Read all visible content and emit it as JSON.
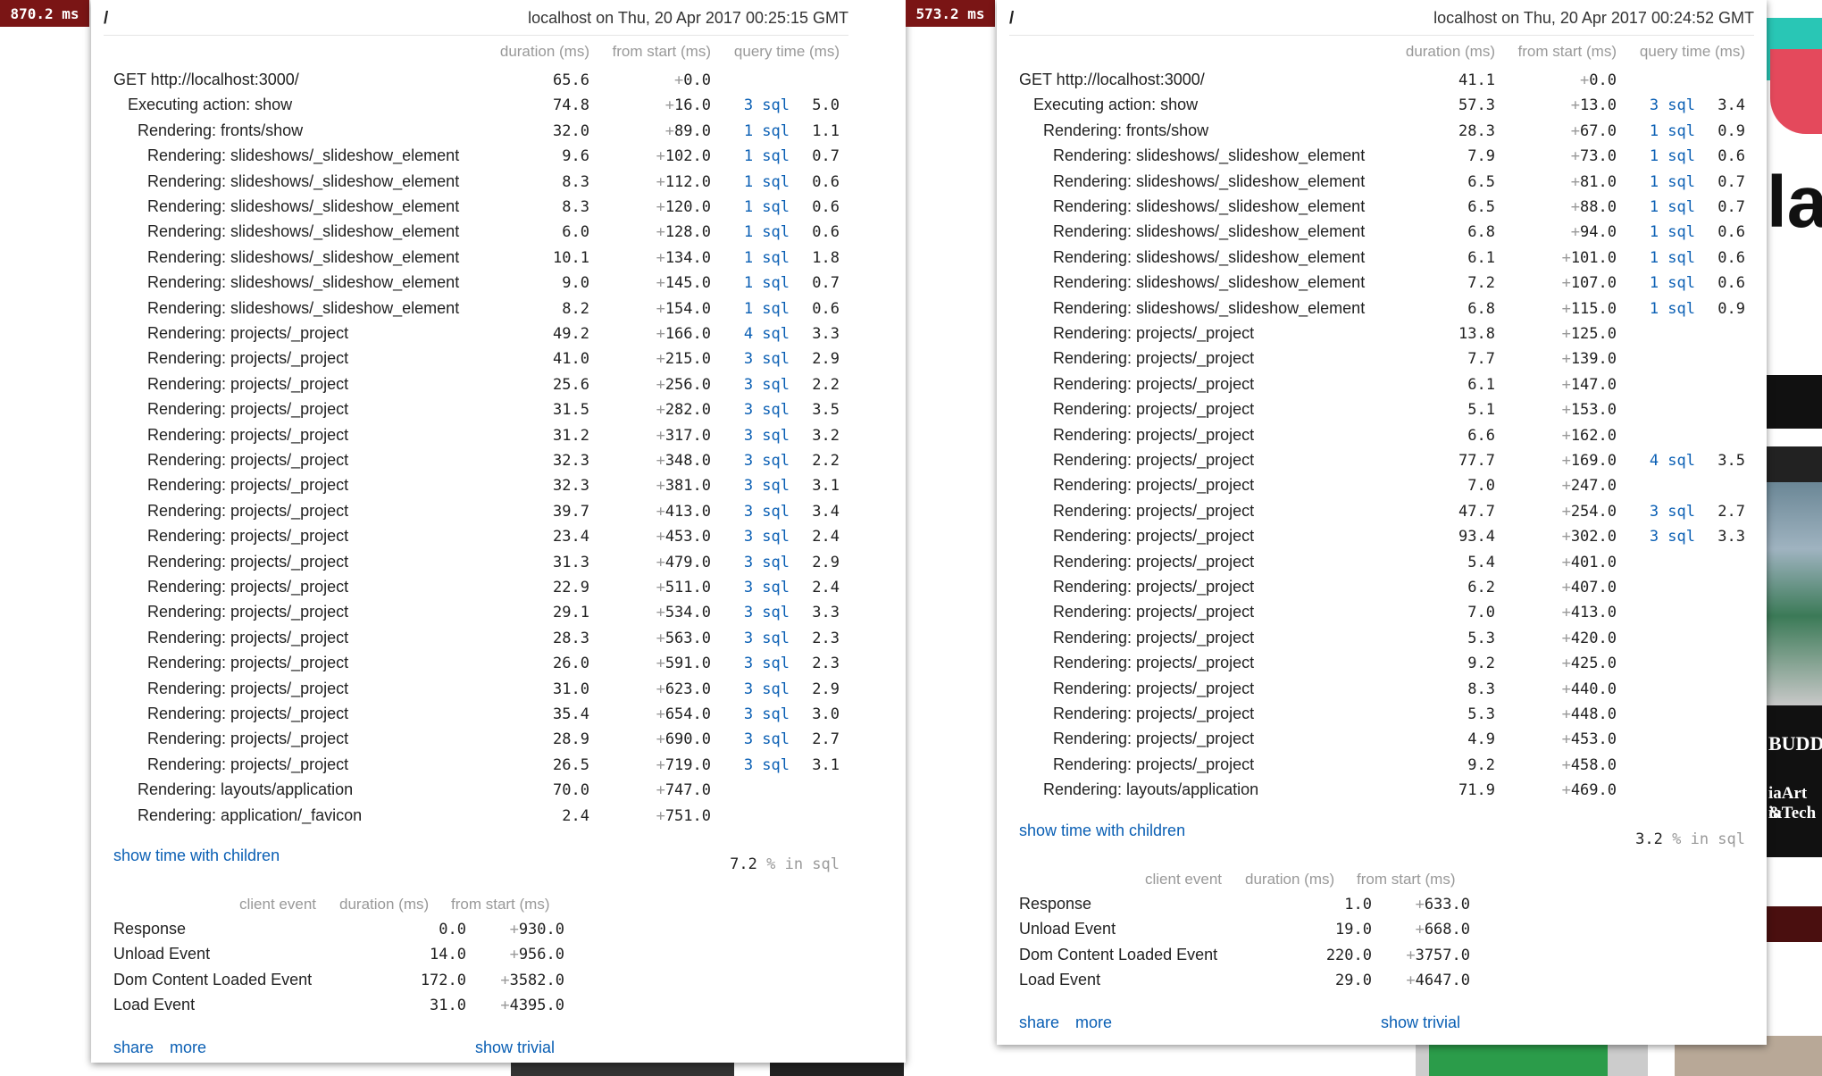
{
  "left": {
    "badge": "870.2 ms",
    "path": "/",
    "host_time": "localhost on Thu, 20 Apr 2017 00:25:15 GMT",
    "columns": {
      "duration": "duration (ms)",
      "from_start": "from start (ms)",
      "query_time": "query time (ms)"
    },
    "timings": [
      {
        "name": "GET http://localhost:3000/",
        "depth": 0,
        "duration": "65.6",
        "start": "0.0",
        "sql": "",
        "query": ""
      },
      {
        "name": "Executing action: show",
        "depth": 1,
        "duration": "74.8",
        "start": "16.0",
        "sql": "3 sql",
        "query": "5.0"
      },
      {
        "name": "Rendering: fronts/show",
        "depth": 2,
        "duration": "32.0",
        "start": "89.0",
        "sql": "1 sql",
        "query": "1.1"
      },
      {
        "name": "Rendering: slideshows/_slideshow_element",
        "depth": 3,
        "duration": "9.6",
        "start": "102.0",
        "sql": "1 sql",
        "query": "0.7"
      },
      {
        "name": "Rendering: slideshows/_slideshow_element",
        "depth": 3,
        "duration": "8.3",
        "start": "112.0",
        "sql": "1 sql",
        "query": "0.6"
      },
      {
        "name": "Rendering: slideshows/_slideshow_element",
        "depth": 3,
        "duration": "8.3",
        "start": "120.0",
        "sql": "1 sql",
        "query": "0.6"
      },
      {
        "name": "Rendering: slideshows/_slideshow_element",
        "depth": 3,
        "duration": "6.0",
        "start": "128.0",
        "sql": "1 sql",
        "query": "0.6"
      },
      {
        "name": "Rendering: slideshows/_slideshow_element",
        "depth": 3,
        "duration": "10.1",
        "start": "134.0",
        "sql": "1 sql",
        "query": "1.8"
      },
      {
        "name": "Rendering: slideshows/_slideshow_element",
        "depth": 3,
        "duration": "9.0",
        "start": "145.0",
        "sql": "1 sql",
        "query": "0.7"
      },
      {
        "name": "Rendering: slideshows/_slideshow_element",
        "depth": 3,
        "duration": "8.2",
        "start": "154.0",
        "sql": "1 sql",
        "query": "0.6"
      },
      {
        "name": "Rendering: projects/_project",
        "depth": 3,
        "duration": "49.2",
        "start": "166.0",
        "sql": "4 sql",
        "query": "3.3"
      },
      {
        "name": "Rendering: projects/_project",
        "depth": 3,
        "duration": "41.0",
        "start": "215.0",
        "sql": "3 sql",
        "query": "2.9"
      },
      {
        "name": "Rendering: projects/_project",
        "depth": 3,
        "duration": "25.6",
        "start": "256.0",
        "sql": "3 sql",
        "query": "2.2"
      },
      {
        "name": "Rendering: projects/_project",
        "depth": 3,
        "duration": "31.5",
        "start": "282.0",
        "sql": "3 sql",
        "query": "3.5"
      },
      {
        "name": "Rendering: projects/_project",
        "depth": 3,
        "duration": "31.2",
        "start": "317.0",
        "sql": "3 sql",
        "query": "3.2"
      },
      {
        "name": "Rendering: projects/_project",
        "depth": 3,
        "duration": "32.3",
        "start": "348.0",
        "sql": "3 sql",
        "query": "2.2"
      },
      {
        "name": "Rendering: projects/_project",
        "depth": 3,
        "duration": "32.3",
        "start": "381.0",
        "sql": "3 sql",
        "query": "3.1"
      },
      {
        "name": "Rendering: projects/_project",
        "depth": 3,
        "duration": "39.7",
        "start": "413.0",
        "sql": "3 sql",
        "query": "3.4"
      },
      {
        "name": "Rendering: projects/_project",
        "depth": 3,
        "duration": "23.4",
        "start": "453.0",
        "sql": "3 sql",
        "query": "2.4"
      },
      {
        "name": "Rendering: projects/_project",
        "depth": 3,
        "duration": "31.3",
        "start": "479.0",
        "sql": "3 sql",
        "query": "2.9"
      },
      {
        "name": "Rendering: projects/_project",
        "depth": 3,
        "duration": "22.9",
        "start": "511.0",
        "sql": "3 sql",
        "query": "2.4"
      },
      {
        "name": "Rendering: projects/_project",
        "depth": 3,
        "duration": "29.1",
        "start": "534.0",
        "sql": "3 sql",
        "query": "3.3"
      },
      {
        "name": "Rendering: projects/_project",
        "depth": 3,
        "duration": "28.3",
        "start": "563.0",
        "sql": "3 sql",
        "query": "2.3"
      },
      {
        "name": "Rendering: projects/_project",
        "depth": 3,
        "duration": "26.0",
        "start": "591.0",
        "sql": "3 sql",
        "query": "2.3"
      },
      {
        "name": "Rendering: projects/_project",
        "depth": 3,
        "duration": "31.0",
        "start": "623.0",
        "sql": "3 sql",
        "query": "2.9"
      },
      {
        "name": "Rendering: projects/_project",
        "depth": 3,
        "duration": "35.4",
        "start": "654.0",
        "sql": "3 sql",
        "query": "3.0"
      },
      {
        "name": "Rendering: projects/_project",
        "depth": 3,
        "duration": "28.9",
        "start": "690.0",
        "sql": "3 sql",
        "query": "2.7"
      },
      {
        "name": "Rendering: projects/_project",
        "depth": 3,
        "duration": "26.5",
        "start": "719.0",
        "sql": "3 sql",
        "query": "3.1"
      },
      {
        "name": "Rendering: layouts/application",
        "depth": 2,
        "duration": "70.0",
        "start": "747.0",
        "sql": "",
        "query": ""
      },
      {
        "name": "Rendering: application/_favicon",
        "depth": 2,
        "duration": "2.4",
        "start": "751.0",
        "sql": "",
        "query": ""
      }
    ],
    "show_children": "show time with children",
    "sql_pct": "7.2",
    "sql_pct_label": "% in sql",
    "client_columns": {
      "event": "client event",
      "duration": "duration (ms)",
      "from_start": "from start (ms)"
    },
    "client_events": [
      {
        "name": "Response",
        "duration": "0.0",
        "start": "930.0"
      },
      {
        "name": "Unload Event",
        "duration": "14.0",
        "start": "956.0"
      },
      {
        "name": "Dom Content Loaded Event",
        "duration": "172.0",
        "start": "3582.0"
      },
      {
        "name": "Load Event",
        "duration": "31.0",
        "start": "4395.0"
      }
    ],
    "share": "share",
    "more": "more",
    "show_trivial": "show trivial"
  },
  "right": {
    "badge": "573.2 ms",
    "path": "/",
    "host_time": "localhost on Thu, 20 Apr 2017 00:24:52 GMT",
    "columns": {
      "duration": "duration (ms)",
      "from_start": "from start (ms)",
      "query_time": "query time (ms)"
    },
    "timings": [
      {
        "name": "GET http://localhost:3000/",
        "depth": 0,
        "duration": "41.1",
        "start": "0.0",
        "sql": "",
        "query": ""
      },
      {
        "name": "Executing action: show",
        "depth": 1,
        "duration": "57.3",
        "start": "13.0",
        "sql": "3 sql",
        "query": "3.4"
      },
      {
        "name": "Rendering: fronts/show",
        "depth": 2,
        "duration": "28.3",
        "start": "67.0",
        "sql": "1 sql",
        "query": "0.9"
      },
      {
        "name": "Rendering: slideshows/_slideshow_element",
        "depth": 3,
        "duration": "7.9",
        "start": "73.0",
        "sql": "1 sql",
        "query": "0.6"
      },
      {
        "name": "Rendering: slideshows/_slideshow_element",
        "depth": 3,
        "duration": "6.5",
        "start": "81.0",
        "sql": "1 sql",
        "query": "0.7"
      },
      {
        "name": "Rendering: slideshows/_slideshow_element",
        "depth": 3,
        "duration": "6.5",
        "start": "88.0",
        "sql": "1 sql",
        "query": "0.7"
      },
      {
        "name": "Rendering: slideshows/_slideshow_element",
        "depth": 3,
        "duration": "6.8",
        "start": "94.0",
        "sql": "1 sql",
        "query": "0.6"
      },
      {
        "name": "Rendering: slideshows/_slideshow_element",
        "depth": 3,
        "duration": "6.1",
        "start": "101.0",
        "sql": "1 sql",
        "query": "0.6"
      },
      {
        "name": "Rendering: slideshows/_slideshow_element",
        "depth": 3,
        "duration": "7.2",
        "start": "107.0",
        "sql": "1 sql",
        "query": "0.6"
      },
      {
        "name": "Rendering: slideshows/_slideshow_element",
        "depth": 3,
        "duration": "6.8",
        "start": "115.0",
        "sql": "1 sql",
        "query": "0.9"
      },
      {
        "name": "Rendering: projects/_project",
        "depth": 3,
        "duration": "13.8",
        "start": "125.0",
        "sql": "",
        "query": ""
      },
      {
        "name": "Rendering: projects/_project",
        "depth": 3,
        "duration": "7.7",
        "start": "139.0",
        "sql": "",
        "query": ""
      },
      {
        "name": "Rendering: projects/_project",
        "depth": 3,
        "duration": "6.1",
        "start": "147.0",
        "sql": "",
        "query": ""
      },
      {
        "name": "Rendering: projects/_project",
        "depth": 3,
        "duration": "5.1",
        "start": "153.0",
        "sql": "",
        "query": ""
      },
      {
        "name": "Rendering: projects/_project",
        "depth": 3,
        "duration": "6.6",
        "start": "162.0",
        "sql": "",
        "query": ""
      },
      {
        "name": "Rendering: projects/_project",
        "depth": 3,
        "duration": "77.7",
        "start": "169.0",
        "sql": "4 sql",
        "query": "3.5"
      },
      {
        "name": "Rendering: projects/_project",
        "depth": 3,
        "duration": "7.0",
        "start": "247.0",
        "sql": "",
        "query": ""
      },
      {
        "name": "Rendering: projects/_project",
        "depth": 3,
        "duration": "47.7",
        "start": "254.0",
        "sql": "3 sql",
        "query": "2.7"
      },
      {
        "name": "Rendering: projects/_project",
        "depth": 3,
        "duration": "93.4",
        "start": "302.0",
        "sql": "3 sql",
        "query": "3.3"
      },
      {
        "name": "Rendering: projects/_project",
        "depth": 3,
        "duration": "5.4",
        "start": "401.0",
        "sql": "",
        "query": ""
      },
      {
        "name": "Rendering: projects/_project",
        "depth": 3,
        "duration": "6.2",
        "start": "407.0",
        "sql": "",
        "query": ""
      },
      {
        "name": "Rendering: projects/_project",
        "depth": 3,
        "duration": "7.0",
        "start": "413.0",
        "sql": "",
        "query": ""
      },
      {
        "name": "Rendering: projects/_project",
        "depth": 3,
        "duration": "5.3",
        "start": "420.0",
        "sql": "",
        "query": ""
      },
      {
        "name": "Rendering: projects/_project",
        "depth": 3,
        "duration": "9.2",
        "start": "425.0",
        "sql": "",
        "query": ""
      },
      {
        "name": "Rendering: projects/_project",
        "depth": 3,
        "duration": "8.3",
        "start": "440.0",
        "sql": "",
        "query": ""
      },
      {
        "name": "Rendering: projects/_project",
        "depth": 3,
        "duration": "5.3",
        "start": "448.0",
        "sql": "",
        "query": ""
      },
      {
        "name": "Rendering: projects/_project",
        "depth": 3,
        "duration": "4.9",
        "start": "453.0",
        "sql": "",
        "query": ""
      },
      {
        "name": "Rendering: projects/_project",
        "depth": 3,
        "duration": "9.2",
        "start": "458.0",
        "sql": "",
        "query": ""
      },
      {
        "name": "Rendering: layouts/application",
        "depth": 2,
        "duration": "71.9",
        "start": "469.0",
        "sql": "",
        "query": ""
      }
    ],
    "show_children": "show time with children",
    "sql_pct": "3.2",
    "sql_pct_label": "% in sql",
    "client_columns": {
      "event": "client event",
      "duration": "duration (ms)",
      "from_start": "from start (ms)"
    },
    "client_events": [
      {
        "name": "Response",
        "duration": "1.0",
        "start": "633.0"
      },
      {
        "name": "Unload Event",
        "duration": "19.0",
        "start": "668.0"
      },
      {
        "name": "Dom Content Loaded Event",
        "duration": "220.0",
        "start": "3757.0"
      },
      {
        "name": "Load Event",
        "duration": "29.0",
        "start": "4647.0"
      }
    ],
    "share": "share",
    "more": "more",
    "show_trivial": "show trivial"
  },
  "background": {
    "fragment_text_1": "iaArt &",
    "fragment_text_2": "iaTech",
    "fragment_text_3": "BUDD",
    "fragment_text_4": "iaArt &",
    "fragment_text_5": "iaTech",
    "fragment_big": "lat"
  }
}
